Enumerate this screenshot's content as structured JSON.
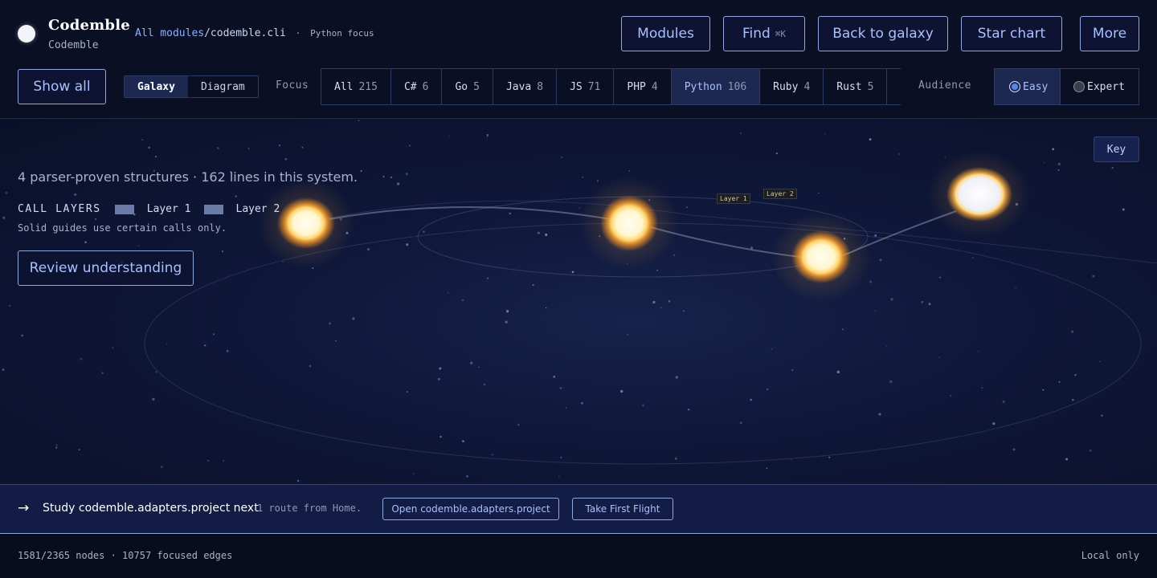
{
  "brand": {
    "title": "Codemble",
    "subtitle": "Codemble"
  },
  "breadcrumb": {
    "root": "All modules",
    "separator": "/",
    "current": "codemble.cli",
    "dot": "·",
    "focus_note": "Python focus"
  },
  "nav": {
    "modules": "Modules",
    "find": "Find",
    "find_shortcut": "⌘K",
    "back": "Back to galaxy",
    "star_chart": "Star chart",
    "more": "More"
  },
  "controls": {
    "show_all": "Show all",
    "view_modes": [
      "Galaxy",
      "Diagram"
    ],
    "active_view": "Galaxy",
    "focus_label": "Focus",
    "languages": [
      {
        "name": "All",
        "count": "215"
      },
      {
        "name": "C#",
        "count": "6"
      },
      {
        "name": "Go",
        "count": "5"
      },
      {
        "name": "Java",
        "count": "8"
      },
      {
        "name": "JS",
        "count": "71"
      },
      {
        "name": "PHP",
        "count": "4"
      },
      {
        "name": "Python",
        "count": "106"
      },
      {
        "name": "Ruby",
        "count": "4"
      },
      {
        "name": "Rust",
        "count": "5"
      }
    ],
    "active_language": "Python",
    "audience_label": "Audience",
    "audience": [
      "Easy",
      "Expert"
    ],
    "active_audience": "Easy"
  },
  "canvas": {
    "key_button": "Key",
    "summary": "4 parser-proven structures · 162 lines in this system.",
    "call_layers_heading": "CALL LAYERS",
    "layer_1": "Layer 1",
    "layer_2": "Layer 2",
    "note": "Solid guides use certain calls only.",
    "review_button": "Review understanding",
    "tag_layer_1": "Layer 1",
    "tag_layer_2": "Layer 2",
    "colors": {
      "star_core": "#fffbe8",
      "star_glow": "#ffb43a",
      "guide_line": "#7e8fc2"
    }
  },
  "next_step": {
    "arrow": "→",
    "text": "Study codemble.adapters.project next",
    "route": "1 route from Home.",
    "open_button": "Open codemble.adapters.project",
    "flight_button": "Take First Flight"
  },
  "status": {
    "nodes": "1581/2365 nodes · 10757 focused edges",
    "mode": "Local only"
  }
}
